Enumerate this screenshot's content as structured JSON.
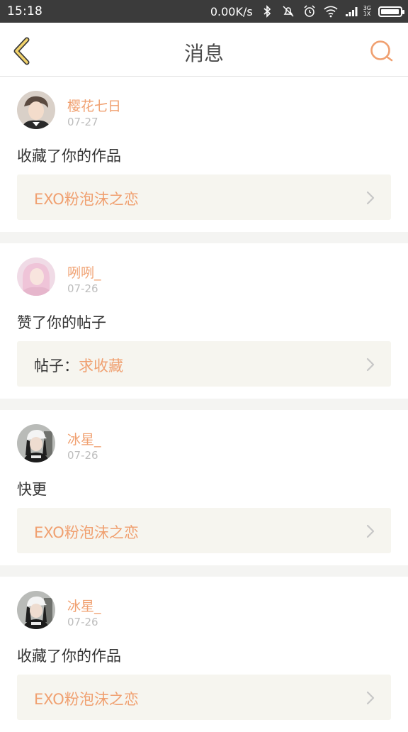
{
  "status_bar": {
    "time": "15:18",
    "speed": "0.00K/s",
    "net_top": "3G",
    "net_bottom": "1X",
    "battery_level": 0.95
  },
  "header": {
    "title": "消息",
    "accent_color": "#f0a070"
  },
  "messages": [
    {
      "user": "樱花七日",
      "date": "07-27",
      "action": "收藏了你的作品",
      "target_prefix": "",
      "target": "EXO粉泡沫之恋",
      "avatar_icon": "avatar-boy-icon"
    },
    {
      "user": "咧咧_",
      "date": "07-26",
      "action": "赞了你的帖子",
      "target_prefix": "帖子：",
      "target": "求收藏",
      "avatar_icon": "avatar-girl-pink-icon"
    },
    {
      "user": "冰星_",
      "date": "07-26",
      "action": "快更",
      "target_prefix": "",
      "target": "EXO粉泡沫之恋",
      "avatar_icon": "avatar-girl-cap-icon"
    },
    {
      "user": "冰星_",
      "date": "07-26",
      "action": "收藏了你的作品",
      "target_prefix": "",
      "target": "EXO粉泡沫之恋",
      "avatar_icon": "avatar-girl-cap-icon"
    }
  ]
}
